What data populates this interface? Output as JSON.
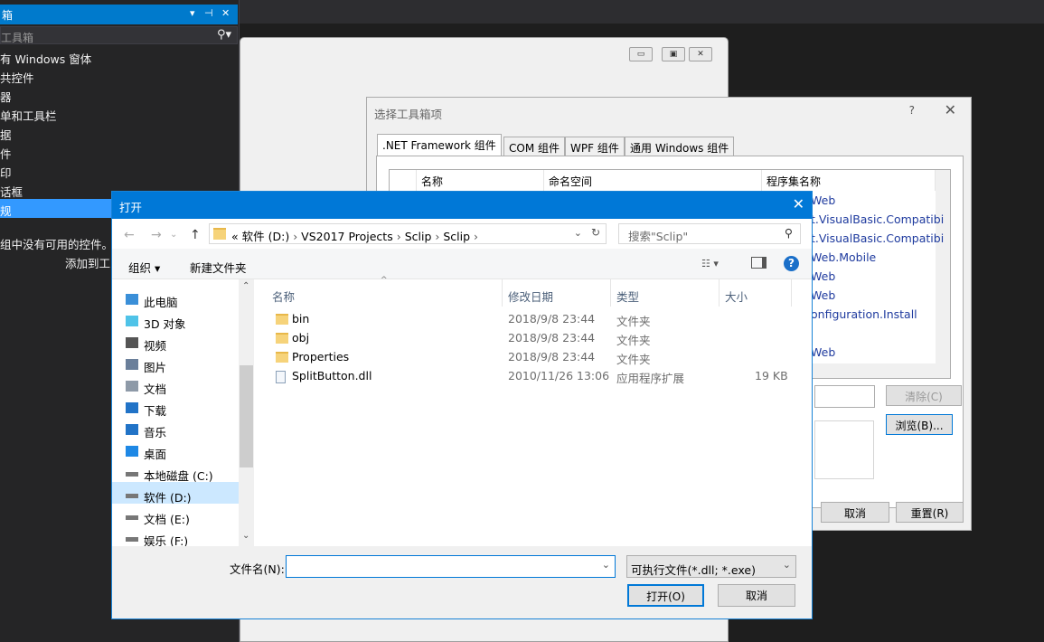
{
  "toolbox": {
    "title": "箱",
    "controls": {
      "dropdown": "▾",
      "pin": "⊣",
      "close": "✕"
    },
    "search_placeholder": "工具箱",
    "items": [
      {
        "label": "有 Windows 窗体"
      },
      {
        "label": "共控件"
      },
      {
        "label": "器"
      },
      {
        "label": "单和工具栏"
      },
      {
        "label": "据"
      },
      {
        "label": "件"
      },
      {
        "label": "印"
      },
      {
        "label": "话框"
      },
      {
        "label": "规",
        "selected": true
      }
    ],
    "empty_line1": "组中没有可用的控件。将",
    "empty_line2": "添加到工"
  },
  "choose_dialog": {
    "title": "选择工具箱项",
    "help": "?",
    "tabs": [
      ".NET Framework 组件",
      "COM 组件",
      "WPF 组件",
      "通用 Windows 组件"
    ],
    "columns": [
      "名称",
      "命名空间",
      "程序集名称"
    ],
    "assembly_rows": [
      "Web",
      "t.VisualBasic.Compatibi",
      "t.VisualBasic.Compatibi",
      "Web.Mobile",
      "Web",
      "Web",
      "onfiguration.Install",
      "",
      "Web"
    ],
    "buttons": {
      "clear": "清除(C)",
      "browse": "浏览(B)...",
      "cancel": "取消",
      "reset": "重置(R)"
    }
  },
  "open_dialog": {
    "title": "打开",
    "breadcrumb": [
      "«",
      "软件 (D:)",
      "VS2017 Projects",
      "Sclip",
      "Sclip"
    ],
    "search_placeholder": "搜索\"Sclip\"",
    "organize": "组织 ▾",
    "new_folder": "新建文件夹",
    "tree": [
      {
        "label": "此电脑",
        "icon": "computer-icon"
      },
      {
        "label": "3D 对象",
        "icon": "cube-icon"
      },
      {
        "label": "视频",
        "icon": "video-icon"
      },
      {
        "label": "图片",
        "icon": "picture-icon"
      },
      {
        "label": "文档",
        "icon": "document-icon"
      },
      {
        "label": "下载",
        "icon": "download-icon"
      },
      {
        "label": "音乐",
        "icon": "music-icon"
      },
      {
        "label": "桌面",
        "icon": "desktop-icon"
      },
      {
        "label": "本地磁盘 (C:)",
        "icon": "drive-icon"
      },
      {
        "label": "软件 (D:)",
        "icon": "drive-icon",
        "selected": true
      },
      {
        "label": "文档 (E:)",
        "icon": "drive-icon"
      },
      {
        "label": "娱乐 (F:)",
        "icon": "drive-icon"
      }
    ],
    "columns": [
      "名称",
      "修改日期",
      "类型",
      "大小"
    ],
    "files": [
      {
        "name": "bin",
        "date": "2018/9/8 23:44",
        "type": "文件夹",
        "size": "",
        "kind": "folder"
      },
      {
        "name": "obj",
        "date": "2018/9/8 23:44",
        "type": "文件夹",
        "size": "",
        "kind": "folder"
      },
      {
        "name": "Properties",
        "date": "2018/9/8 23:44",
        "type": "文件夹",
        "size": "",
        "kind": "folder"
      },
      {
        "name": "SplitButton.dll",
        "date": "2010/11/26 13:06",
        "type": "应用程序扩展",
        "size": "19 KB",
        "kind": "dll"
      }
    ],
    "filename_label": "文件名(N):",
    "filename_value": "",
    "filetype": "可执行文件(*.dll; *.exe)",
    "open_button": "打开(O)",
    "cancel_button": "取消"
  }
}
